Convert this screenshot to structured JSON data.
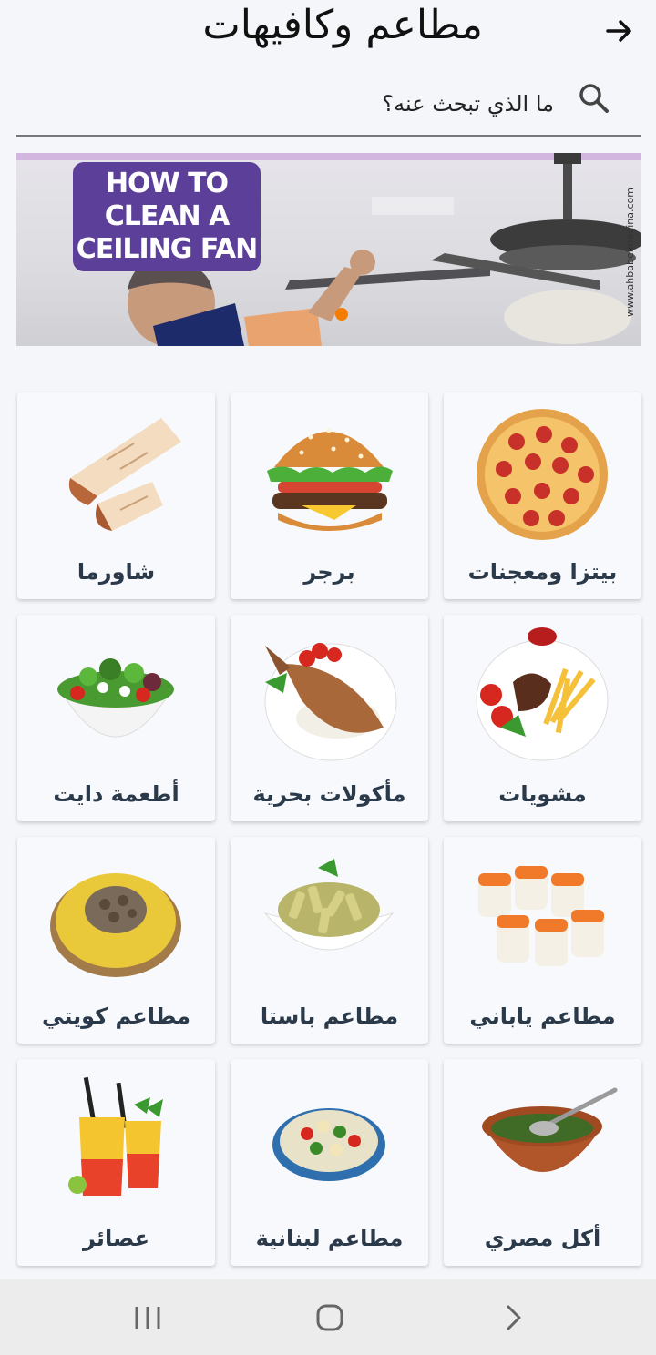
{
  "header": {
    "title": "مطاعم وكافيهات",
    "back_icon": "arrow-right-icon"
  },
  "search": {
    "placeholder": "ما الذي تبحث عنه؟",
    "icon": "search-icon"
  },
  "banner": {
    "headline": "HOW TO CLEAN A CEILING FAN",
    "watermark": "www.ahbabelmadina.com"
  },
  "categories": [
    {
      "label": "بيتزا ومعجنات",
      "icon": "pizza-image"
    },
    {
      "label": "برجر",
      "icon": "burger-image"
    },
    {
      "label": "شاورما",
      "icon": "shawarma-image"
    },
    {
      "label": "مشويات",
      "icon": "grill-image"
    },
    {
      "label": "مأكولات بحرية",
      "icon": "seafood-image"
    },
    {
      "label": "أطعمة دايت",
      "icon": "salad-image"
    },
    {
      "label": "مطاعم ياباني",
      "icon": "sushi-image"
    },
    {
      "label": "مطاعم باستا",
      "icon": "pasta-image"
    },
    {
      "label": "مطاعم كويتي",
      "icon": "kuwaiti-rice-image"
    },
    {
      "label": "أكل مصري",
      "icon": "molokhia-image"
    },
    {
      "label": "مطاعم لبنانية",
      "icon": "lebanese-salad-image"
    },
    {
      "label": "عصائر",
      "icon": "juice-image"
    }
  ],
  "colors": {
    "accent": "#f57c00",
    "banner_card": "#5b3f98",
    "label": "#2b3a4a"
  },
  "navbar": {
    "recent": "recent-apps-icon",
    "home": "home-icon",
    "back": "back-chevron-icon"
  }
}
